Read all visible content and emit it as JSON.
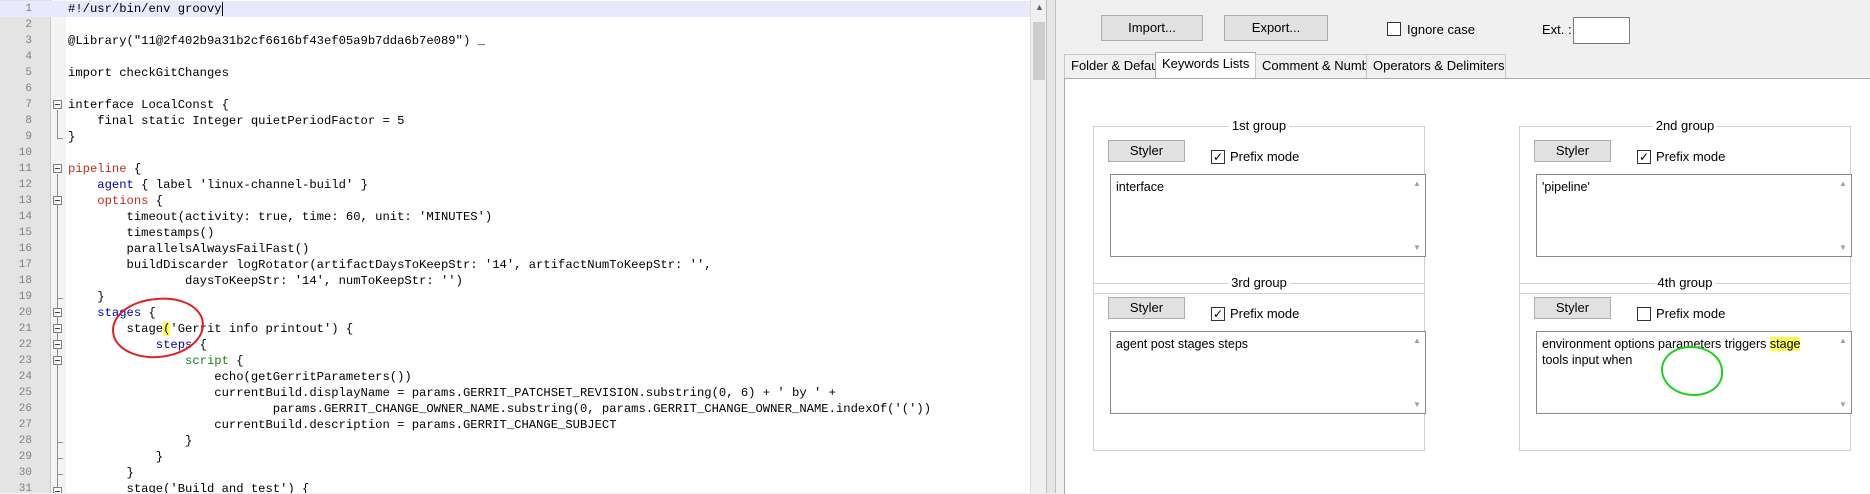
{
  "editor": {
    "lines": [
      {
        "n": "1",
        "segs": [
          {
            "t": "#!/usr/bin/env groovy",
            "c": ""
          }
        ]
      },
      {
        "n": "2",
        "segs": []
      },
      {
        "n": "3",
        "segs": [
          {
            "t": "@Library(\"11@2f402b9a31b2cf6616bf43ef05a9b7dda6b7e089\") _",
            "c": ""
          }
        ]
      },
      {
        "n": "4",
        "segs": []
      },
      {
        "n": "5",
        "segs": [
          {
            "t": "import checkGitChanges",
            "c": ""
          }
        ]
      },
      {
        "n": "6",
        "segs": []
      },
      {
        "n": "7",
        "segs": [
          {
            "t": "interface LocalConst {",
            "c": ""
          }
        ]
      },
      {
        "n": "8",
        "segs": [
          {
            "t": "    final static Integer quietPeriodFactor = 5",
            "c": ""
          }
        ]
      },
      {
        "n": "9",
        "segs": [
          {
            "t": "}",
            "c": ""
          }
        ]
      },
      {
        "n": "10",
        "segs": []
      },
      {
        "n": "11",
        "segs": [
          {
            "t": "pipeline",
            "c": "kw-red"
          },
          {
            "t": " {",
            "c": ""
          }
        ]
      },
      {
        "n": "12",
        "segs": [
          {
            "t": "    ",
            "c": ""
          },
          {
            "t": "agent",
            "c": "kw-blue"
          },
          {
            "t": " { label 'linux-channel-build' }",
            "c": ""
          }
        ]
      },
      {
        "n": "13",
        "segs": [
          {
            "t": "    ",
            "c": ""
          },
          {
            "t": "options",
            "c": "kw-red"
          },
          {
            "t": " {",
            "c": ""
          }
        ]
      },
      {
        "n": "14",
        "segs": [
          {
            "t": "        timeout(activity: true, time: 60, unit: 'MINUTES')",
            "c": ""
          }
        ]
      },
      {
        "n": "15",
        "segs": [
          {
            "t": "        timestamps()",
            "c": ""
          }
        ]
      },
      {
        "n": "16",
        "segs": [
          {
            "t": "        parallelsAlwaysFailFast()",
            "c": ""
          }
        ]
      },
      {
        "n": "17",
        "segs": [
          {
            "t": "        buildDiscarder logRotator(artifactDaysToKeepStr: '14', artifactNumToKeepStr: '',",
            "c": ""
          }
        ]
      },
      {
        "n": "18",
        "segs": [
          {
            "t": "                daysToKeepStr: '14', numToKeepStr: '')",
            "c": ""
          }
        ]
      },
      {
        "n": "19",
        "segs": [
          {
            "t": "    }",
            "c": ""
          }
        ]
      },
      {
        "n": "20",
        "segs": [
          {
            "t": "    ",
            "c": ""
          },
          {
            "t": "stages",
            "c": "kw-blue"
          },
          {
            "t": " {",
            "c": ""
          }
        ]
      },
      {
        "n": "21",
        "segs": [
          {
            "t": "        stage",
            "c": ""
          },
          {
            "t": "(",
            "c": "hl-yellow"
          },
          {
            "t": "'Gerrit info printout') {",
            "c": ""
          }
        ]
      },
      {
        "n": "22",
        "segs": [
          {
            "t": "            ",
            "c": ""
          },
          {
            "t": "steps",
            "c": "kw-blue"
          },
          {
            "t": " {",
            "c": ""
          }
        ]
      },
      {
        "n": "23",
        "segs": [
          {
            "t": "                ",
            "c": ""
          },
          {
            "t": "script",
            "c": "kw-green"
          },
          {
            "t": " {",
            "c": ""
          }
        ]
      },
      {
        "n": "24",
        "segs": [
          {
            "t": "                    echo(getGerritParameters())",
            "c": ""
          }
        ]
      },
      {
        "n": "25",
        "segs": [
          {
            "t": "                    currentBuild.displayName = params.GERRIT_PATCHSET_REVISION.substring(0, 6) + ' by ' +",
            "c": ""
          }
        ]
      },
      {
        "n": "26",
        "segs": [
          {
            "t": "                            params.GERRIT_CHANGE_OWNER_NAME.substring(0, params.GERRIT_CHANGE_OWNER_NAME.indexOf('('))",
            "c": ""
          }
        ]
      },
      {
        "n": "27",
        "segs": [
          {
            "t": "                    currentBuild.description = params.GERRIT_CHANGE_SUBJECT",
            "c": ""
          }
        ]
      },
      {
        "n": "28",
        "segs": [
          {
            "t": "                }",
            "c": ""
          }
        ]
      },
      {
        "n": "29",
        "segs": [
          {
            "t": "            }",
            "c": ""
          }
        ]
      },
      {
        "n": "30",
        "segs": [
          {
            "t": "        }",
            "c": ""
          }
        ]
      },
      {
        "n": "31",
        "segs": [
          {
            "t": "        stage('Build and test') {",
            "c": ""
          }
        ]
      }
    ]
  },
  "toolbar": {
    "import_label": "Import...",
    "export_label": "Export...",
    "ignore_case_label": "Ignore case",
    "ignore_case_checked": false,
    "ext_label": "Ext. :",
    "ext_value": ""
  },
  "tabs": [
    {
      "label": "Folder & Default",
      "active": false
    },
    {
      "label": "Keywords Lists",
      "active": true
    },
    {
      "label": "Comment & Number",
      "active": false
    },
    {
      "label": "Operators & Delimiters",
      "active": false
    }
  ],
  "groups": [
    {
      "title": "1st group",
      "styler": "Styler",
      "prefix_label": "Prefix mode",
      "prefix_checked": true,
      "keywords": "interface"
    },
    {
      "title": "2nd group",
      "styler": "Styler",
      "prefix_label": "Prefix mode",
      "prefix_checked": true,
      "keywords": "'pipeline'"
    },
    {
      "title": "3rd group",
      "styler": "Styler",
      "prefix_label": "Prefix mode",
      "prefix_checked": true,
      "keywords": "agent post stages steps"
    },
    {
      "title": "4th group",
      "styler": "Styler",
      "prefix_label": "Prefix mode",
      "prefix_checked": false,
      "keywords_before": "environment options parameters triggers ",
      "keywords_highlight": "stage",
      "keywords_after": " tools input when"
    }
  ],
  "colors": {
    "annotation_red": "#e02020",
    "annotation_green": "#20d020",
    "highlight": "#ffff50"
  }
}
